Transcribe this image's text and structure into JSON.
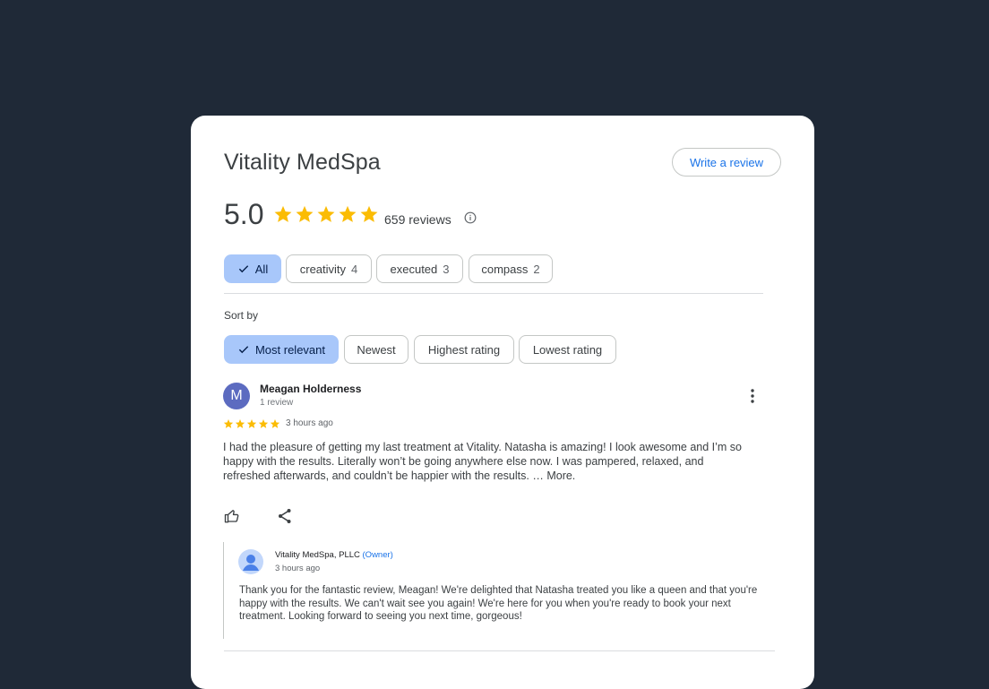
{
  "business": {
    "name": "Vitality MedSpa",
    "write_review_label": "Write a review",
    "rating": "5.0",
    "stars": 5,
    "review_count": "659 reviews"
  },
  "colors": {
    "star": "#fbbc04",
    "selected_chip": "#a8c7fa",
    "link": "#1a73e8"
  },
  "filters": {
    "chips": [
      {
        "label": "All",
        "count": "",
        "selected": true
      },
      {
        "label": "creativity",
        "count": "4",
        "selected": false
      },
      {
        "label": "executed",
        "count": "3",
        "selected": false
      },
      {
        "label": "compass",
        "count": "2",
        "selected": false
      }
    ]
  },
  "sort": {
    "label": "Sort by",
    "options": [
      {
        "label": "Most relevant",
        "selected": true
      },
      {
        "label": "Newest",
        "selected": false
      },
      {
        "label": "Highest rating",
        "selected": false
      },
      {
        "label": "Lowest rating",
        "selected": false
      }
    ]
  },
  "review": {
    "initial": "M",
    "author": "Meagan Holderness",
    "author_sub": "1 review",
    "stars": 5,
    "time": "3 hours ago",
    "text": "I had the pleasure of getting my last treatment at Vitality. Natasha is amazing! I look awesome and I’m so happy with the results. Literally won’t be going anywhere else now. I was pampered, relaxed, and refreshed afterwards, and couldn’t be happier with the results. …",
    "more_label": "More."
  },
  "reply": {
    "owner": "Vitality MedSpa, PLLC",
    "owner_tag": "(Owner)",
    "time": "3 hours ago",
    "text": "Thank you for the fantastic review, Meagan! We're delighted that Natasha treated you like a queen and that you're happy with the results. We can't wait see you again! We're here for you when you're ready to book your next treatment. Looking forward to seeing you next time, gorgeous!"
  }
}
